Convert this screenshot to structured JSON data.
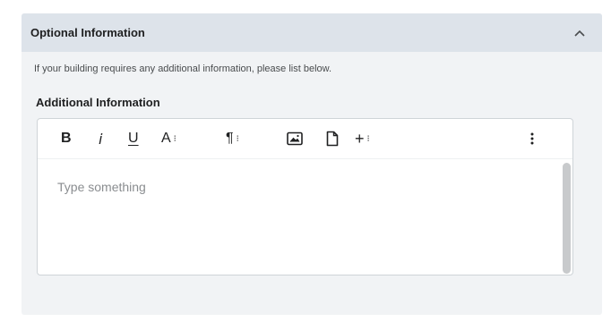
{
  "panel": {
    "title": "Optional Information",
    "helper_text": "If your building requires any additional information, please list below.",
    "field_label": "Additional Information"
  },
  "editor": {
    "toolbar": {
      "bold": "B",
      "italic": "i",
      "underline": "U",
      "font": "A",
      "paragraph": "¶",
      "insert": "+"
    },
    "placeholder": "Type something"
  },
  "icons": {
    "collapse": "chevron-up-icon",
    "image": "image-icon",
    "document": "document-icon",
    "more": "more-vertical-icon"
  }
}
